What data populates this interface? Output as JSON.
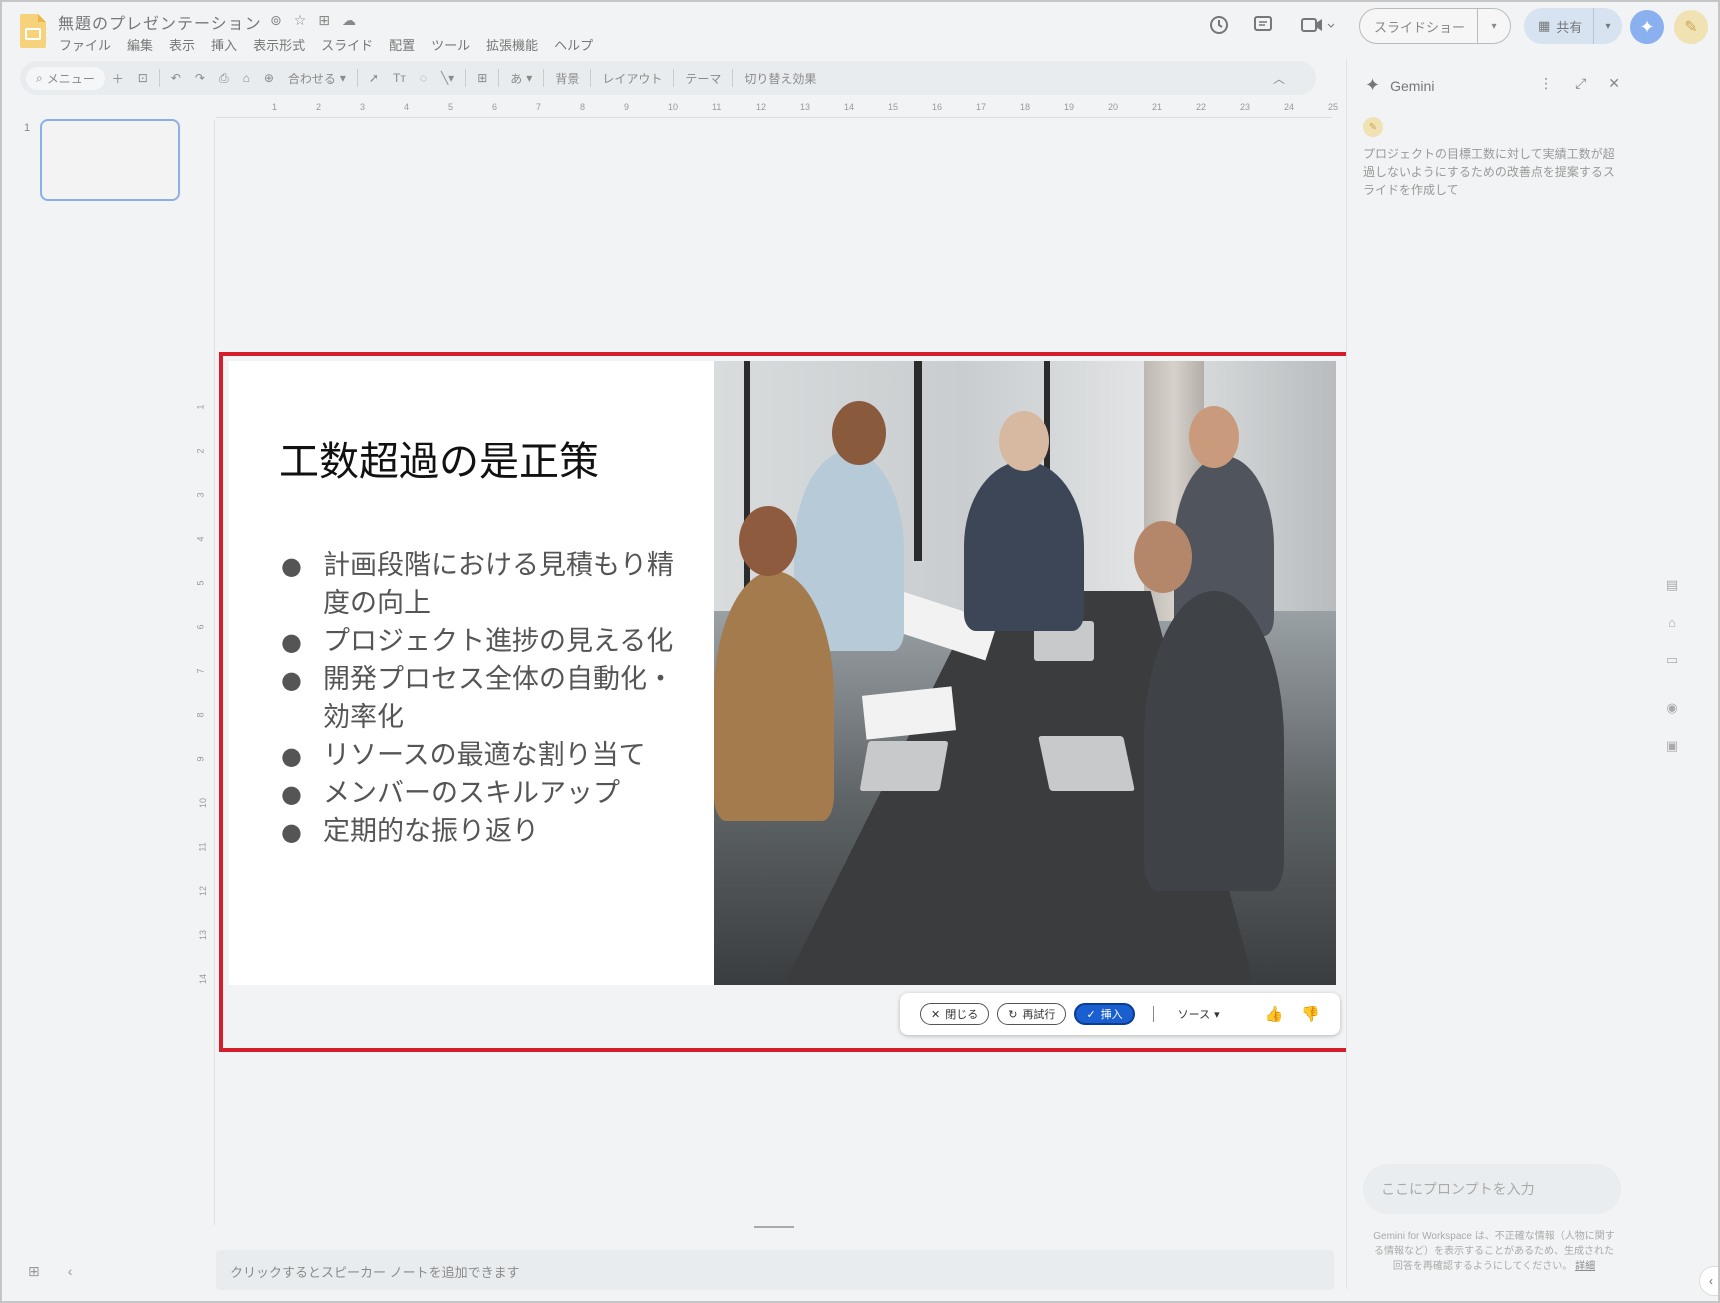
{
  "app": {
    "doc_title": "無題のプレゼンテーション",
    "menu": [
      "ファイル",
      "編集",
      "表示",
      "挿入",
      "表示形式",
      "スライド",
      "配置",
      "ツール",
      "拡張機能",
      "ヘルプ"
    ]
  },
  "header": {
    "slideshow_label": "スライドショー",
    "share_label": "共有"
  },
  "toolbar": {
    "menu_search": "メニュー",
    "zoom": "合わせる",
    "ime": "あ",
    "background": "背景",
    "layout": "レイアウト",
    "theme": "テーマ",
    "transition": "切り替え効果"
  },
  "ruler": {
    "h_ticks": [
      "1",
      "2",
      "3",
      "4",
      "5",
      "6",
      "7",
      "8",
      "9",
      "10",
      "11",
      "12",
      "13",
      "14",
      "15",
      "16",
      "17",
      "18",
      "19",
      "20",
      "21",
      "22",
      "23",
      "24",
      "25"
    ],
    "v_ticks": [
      "1",
      "2",
      "3",
      "4",
      "5",
      "6",
      "7",
      "8",
      "9",
      "10",
      "11",
      "12",
      "13",
      "14"
    ]
  },
  "filmstrip": {
    "slide_number": "1"
  },
  "slide": {
    "title": "工数超過の是正策",
    "bullets": [
      "計画段階における見積もり精度の向上",
      "プロジェクト進捗の見える化",
      "開発プロセス全体の自動化・効率化",
      "リソースの最適な割り当て",
      "メンバーのスキルアップ",
      "定期的な振り返り"
    ]
  },
  "ai_bar": {
    "close_label": "閉じる",
    "retry_label": "再試行",
    "insert_label": "挿入",
    "source_label": "ソース"
  },
  "notes": {
    "placeholder": "クリックするとスピーカー ノートを追加できます"
  },
  "gemini": {
    "title": "Gemini",
    "prompt_text": "プロジェクトの目標工数に対して実績工数が超過しないようにするための改善点を提案するスライドを作成して",
    "input_placeholder": "ここにプロンプトを入力",
    "disclaimer": "Gemini for Workspace は、不正確な情報（人物に関する情報など）を表示することがあるため、生成された回答を再確認するようにしてください。",
    "disclaimer_link": "詳細"
  },
  "colors": {
    "accent_blue": "#1a5fd0",
    "highlight_red": "#d51e2b",
    "app_yellow": "#f4b400"
  }
}
